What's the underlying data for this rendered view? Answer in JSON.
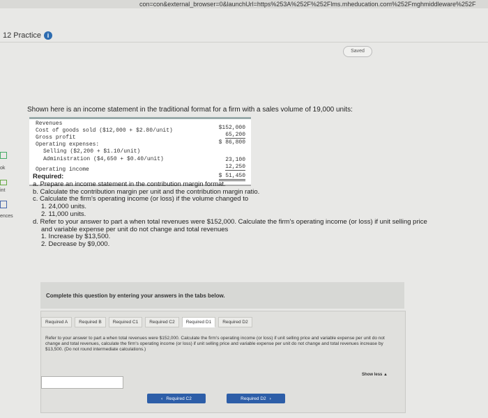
{
  "browser": {
    "url": "con=con&external_browser=0&launchUrl=https%253A%252F%252Flms.mheducation.com%252Fmghmiddleware%252F"
  },
  "header": {
    "practice_label": "12 Practice",
    "info_glyph": "i",
    "saved_label": "Saved"
  },
  "sidebar": {
    "items": [
      "ok",
      "int",
      "ences"
    ]
  },
  "intro": "Shown here is an income statement in the traditional format for a firm with a sales volume of 19,000 units:",
  "statement": {
    "rows": [
      {
        "label": "Revenues",
        "amount": "$152,000"
      },
      {
        "label": "Cost of goods sold ($12,000 + $2.80/unit)",
        "amount": "65,200"
      },
      {
        "label": "Gross profit",
        "amount": "$ 86,800"
      },
      {
        "label": "Operating expenses:",
        "amount": ""
      },
      {
        "label": "Selling ($2,200 + $1.10/unit)",
        "amount": "23,100"
      },
      {
        "label": "Administration ($4,650 + $0.40/unit)",
        "amount": "12,250"
      },
      {
        "label": "Operating income",
        "amount": "$ 51,450"
      }
    ]
  },
  "required": {
    "heading": "Required:",
    "lines": [
      "a. Prepare an income statement in the contribution margin format.",
      "b. Calculate the contribution margin per unit and the contribution margin ratio.",
      "c. Calculate the firm's operating income (or loss) if the volume changed to",
      "1. 24,000 units.",
      "2. 11,000 units.",
      "d. Refer to your answer to part a when total revenues were $152,000. Calculate the firm's operating income (or loss) if unit selling price",
      "and variable expense per unit do not change and total revenues",
      "1. Increase by $13,500.",
      "2. Decrease by $9,000."
    ]
  },
  "complete_prompt": "Complete this question by entering your answers in the tabs below.",
  "tabs": [
    "Required A",
    "Required B",
    "Required C1",
    "Required C2",
    "Required D1",
    "Required D2"
  ],
  "active_tab": "Required D1",
  "question_text": "Refer to your answer to part a when total revenues were $152,000. Calculate the firm's operating income (or loss) if unit selling price and variable expense per unit do not change and total revenues, calculate the firm's operating income (or loss) if unit selling price and variable expense per unit do not change and total revenues increase by $13,500. (Do not round intermediate calculations.)",
  "answer_value": "",
  "show_less_label": "Show less ▲",
  "nav": {
    "prev_label": "Required C2",
    "next_label": "Required D2",
    "prev_glyph": "‹",
    "next_glyph": "›"
  }
}
